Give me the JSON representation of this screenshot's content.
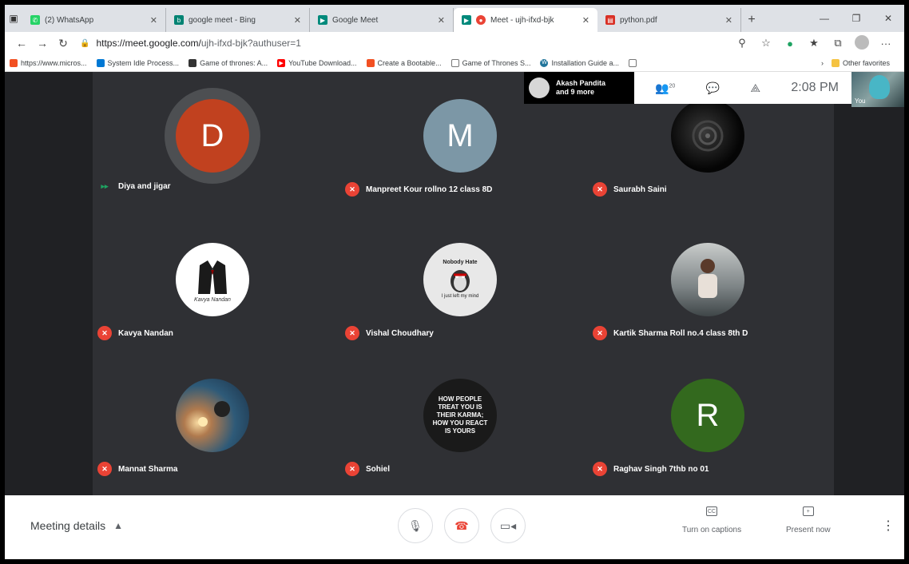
{
  "browser": {
    "tabs": [
      {
        "label": "(2) WhatsApp",
        "color": "#25d366",
        "glyph": "✆"
      },
      {
        "label": "google meet - Bing",
        "color": "#008373",
        "glyph": "b"
      },
      {
        "label": "Google Meet",
        "color": "#00897b",
        "glyph": "▶"
      },
      {
        "label": "Meet - ujh-ifxd-bjk",
        "color": "#ea4335",
        "glyph": "●"
      },
      {
        "label": "python.pdf",
        "color": "#d93025",
        "glyph": "▤"
      }
    ],
    "active_tab": 3,
    "url_host": "https://meet.google.com/",
    "url_path": "ujh-ifxd-bjk?authuser=1",
    "bookmarks": [
      {
        "label": "https://www.micros...",
        "color": "#f25022"
      },
      {
        "label": "System Idle Process...",
        "color": "#0078d4"
      },
      {
        "label": "Game of thrones: A...",
        "color": "#333333"
      },
      {
        "label": "YouTube Download...",
        "color": "#ff0000"
      },
      {
        "label": "Create a Bootable...",
        "color": "#f25022"
      },
      {
        "label": "Game of Thrones S...",
        "color": "#777777"
      },
      {
        "label": "Installation Guide a...",
        "color": "#21759b"
      }
    ],
    "other_favorites": "Other favorites"
  },
  "meeting": {
    "presenter_line1": "Akash Pandita",
    "presenter_line2": "and 9 more",
    "participant_count": "20",
    "time": "2:08 PM",
    "self_label": "You",
    "participants": [
      {
        "name": "Diya and jigar",
        "initial": "D",
        "color": "#c1411f",
        "muted": false
      },
      {
        "name": "Manpreet Kour rollno 12 class 8D",
        "initial": "M",
        "color": "#7c97a6",
        "muted": true
      },
      {
        "name": "Saurabh Saini",
        "initial": "",
        "color": "#111111",
        "muted": true
      },
      {
        "name": "Kavya Nandan",
        "initial": "",
        "color": "#ffffff",
        "muted": true
      },
      {
        "name": "Vishal Choudhary",
        "initial": "",
        "color": "#e8e8e8",
        "muted": true
      },
      {
        "name": "Kartik Sharma Roll no.4 class 8th D",
        "initial": "",
        "color": "#8a8f92",
        "muted": true
      },
      {
        "name": "Mannat Sharma",
        "initial": "",
        "color": "#3a6e8c",
        "muted": true
      },
      {
        "name": "Sohiel",
        "initial": "",
        "color": "#1a1a1a",
        "muted": true
      },
      {
        "name": "Raghav Singh 7thb no 01",
        "initial": "R",
        "color": "#33691e",
        "muted": true
      }
    ],
    "tile_texts": {
      "kavya_logo": "Kavya Nandan",
      "vishal_top": "Nobody Hate",
      "vishal_bottom": "I just left my mind",
      "sohiel_quote": "HOW PEOPLE TREAT YOU IS THEIR KARMA; HOW YOU REACT IS YOURS"
    },
    "meeting_details": "Meeting details",
    "captions_label": "Turn on captions",
    "present_label": "Present now"
  }
}
